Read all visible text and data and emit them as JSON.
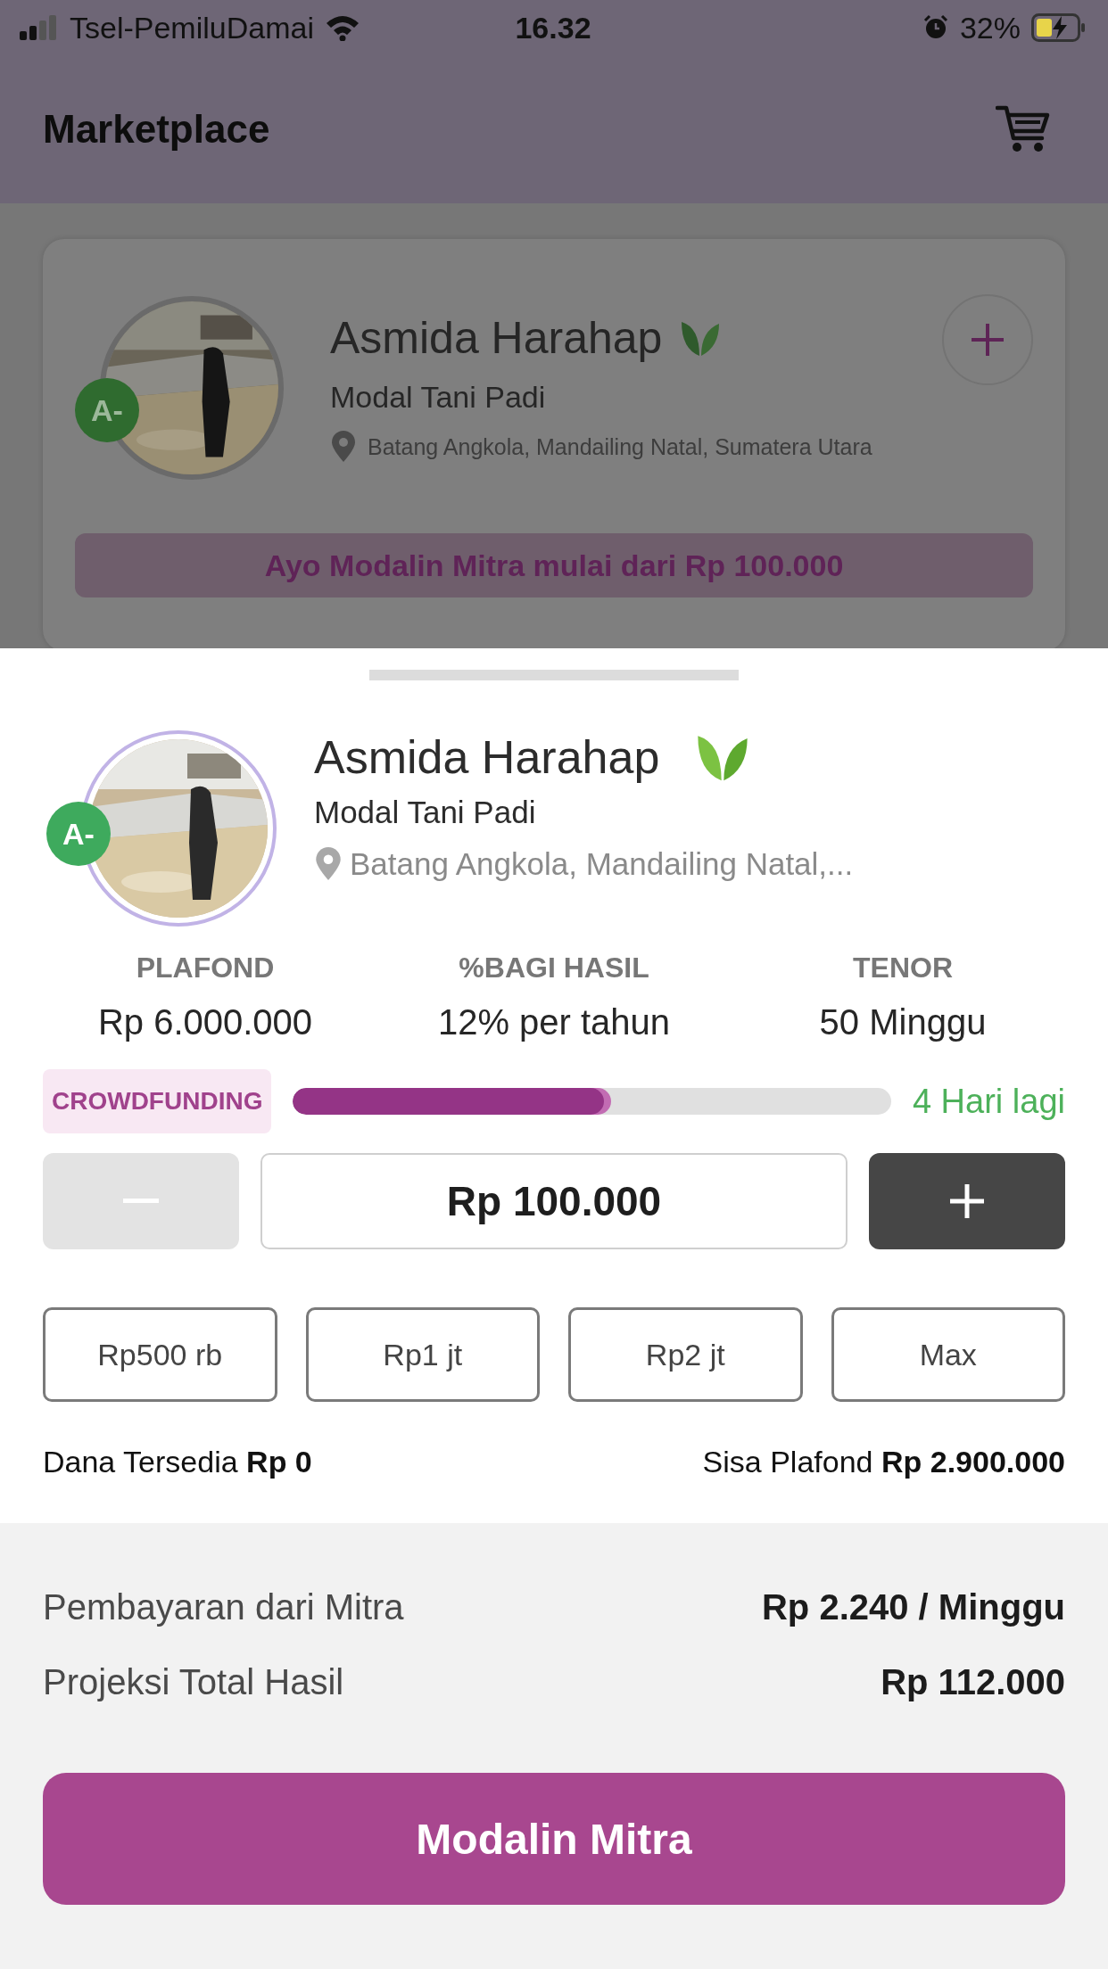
{
  "status_bar": {
    "carrier": "Tsel-PemiluDamai",
    "time": "16.32",
    "battery": "32%"
  },
  "header": {
    "title": "Marketplace"
  },
  "background_card": {
    "grade": "A-",
    "name": "Asmida Harahap",
    "subtitle": "Modal Tani Padi",
    "location": "Batang Angkola, Mandailing Natal, Sumatera Utara",
    "banner": "Ayo Modalin Mitra mulai dari Rp 100.000"
  },
  "sheet": {
    "grade": "A-",
    "name": "Asmida Harahap",
    "subtitle": "Modal Tani Padi",
    "location": "Batang Angkola, Mandailing Natal,...",
    "stats": [
      {
        "label": "PLAFOND",
        "value": "Rp 6.000.000"
      },
      {
        "label": "%BAGI HASIL",
        "value": "12% per tahun"
      },
      {
        "label": "TENOR",
        "value": "50 Minggu"
      }
    ],
    "tag": "CROWDFUNDING",
    "progress": {
      "level": 0.52
    },
    "days_left": "4 Hari lagi",
    "stepper": {
      "amount": "Rp 100.000",
      "minus_disabled": true
    },
    "quick_amounts": [
      "Rp500 rb",
      "Rp1 jt",
      "Rp2 jt",
      "Max"
    ],
    "available": "Dana Tersedia **Rp 0**",
    "remaining": "Sisa Plafond **Rp 2.900.000**"
  },
  "summary": [
    {
      "label": "Pembayaran dari Mitra",
      "value": "Rp 2.240 / Minggu"
    },
    {
      "label": "Projeksi Total Hasil",
      "value": "Rp 112.000"
    }
  ],
  "cta": "Modalin Mitra"
}
